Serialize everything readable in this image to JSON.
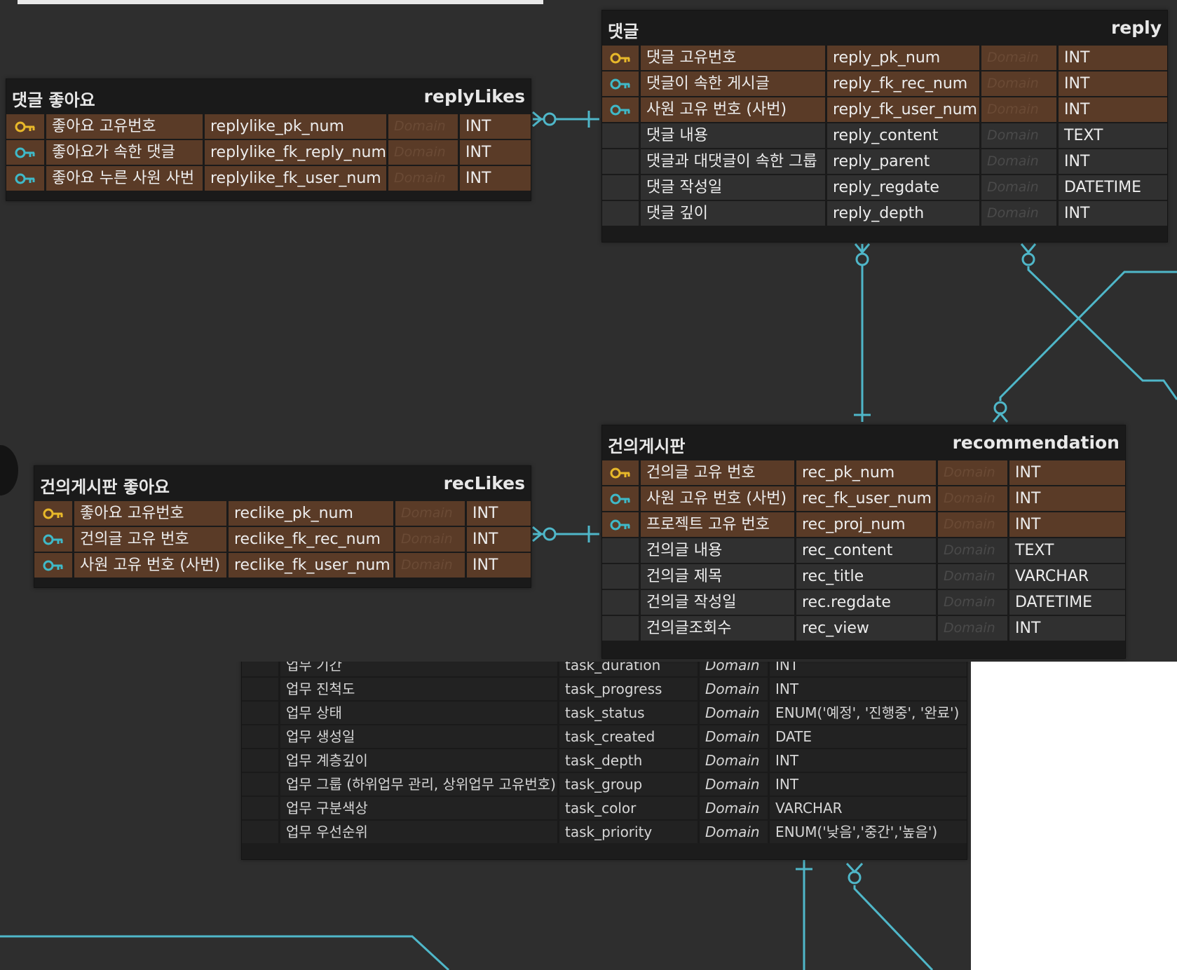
{
  "colors": {
    "link": "#4fb7c9",
    "key_row": "#5a3b27",
    "pk_icon": "#e8b82a",
    "fk_icon": "#3fb9c8",
    "panel": "#2e2e2e"
  },
  "tables": {
    "replyLikes": {
      "kor": "댓글 좋아요",
      "eng": "replyLikes",
      "rows": [
        {
          "icon": "pk-key-icon",
          "kor": "좋아요 고유번호",
          "eng": "replylike_pk_num",
          "domain": "Domain",
          "type": "INT"
        },
        {
          "icon": "fk-key-icon",
          "kor": "좋아요가 속한 댓글",
          "eng": "replylike_fk_reply_num",
          "domain": "Domain",
          "type": "INT"
        },
        {
          "icon": "fk-key-icon",
          "kor": "좋아요 누른 사원 사번",
          "eng": "replylike_fk_user_num",
          "domain": "Domain",
          "type": "INT"
        }
      ]
    },
    "reply": {
      "kor": "댓글",
      "eng": "reply",
      "rows": [
        {
          "icon": "pk-key-icon",
          "kor": "댓글 고유번호",
          "eng": "reply_pk_num",
          "domain": "Domain",
          "type": "INT"
        },
        {
          "icon": "fk-key-icon",
          "kor": "댓글이 속한 게시글",
          "eng": "reply_fk_rec_num",
          "domain": "Domain",
          "type": "INT"
        },
        {
          "icon": "fk-key-icon",
          "kor": "사원 고유 번호 (사번)",
          "eng": "reply_fk_user_num",
          "domain": "Domain",
          "type": "INT"
        },
        {
          "icon": "",
          "kor": "댓글 내용",
          "eng": "reply_content",
          "domain": "Domain",
          "type": "TEXT"
        },
        {
          "icon": "",
          "kor": "댓글과 대댓글이 속한 그룹",
          "eng": "reply_parent",
          "domain": "Domain",
          "type": "INT"
        },
        {
          "icon": "",
          "kor": "댓글 작성일",
          "eng": "reply_regdate",
          "domain": "Domain",
          "type": "DATETIME"
        },
        {
          "icon": "",
          "kor": "댓글 깊이",
          "eng": "reply_depth",
          "domain": "Domain",
          "type": "INT"
        }
      ]
    },
    "recLikes": {
      "kor": "건의게시판 좋아요",
      "eng": "recLikes",
      "rows": [
        {
          "icon": "pk-key-icon",
          "kor": "좋아요 고유번호",
          "eng": "reclike_pk_num",
          "domain": "Domain",
          "type": "INT"
        },
        {
          "icon": "fk-key-icon",
          "kor": "건의글 고유 번호",
          "eng": "reclike_fk_rec_num",
          "domain": "Domain",
          "type": "INT"
        },
        {
          "icon": "fk-key-icon",
          "kor": "사원 고유 번호 (사번)",
          "eng": "reclike_fk_user_num",
          "domain": "Domain",
          "type": "INT"
        }
      ]
    },
    "recommendation": {
      "kor": "건의게시판",
      "eng": "recommendation",
      "rows": [
        {
          "icon": "pk-key-icon",
          "kor": "건의글 고유 번호",
          "eng": "rec_pk_num",
          "domain": "Domain",
          "type": "INT"
        },
        {
          "icon": "fk-key-icon",
          "kor": "사원 고유 번호 (사번)",
          "eng": "rec_fk_user_num",
          "domain": "Domain",
          "type": "INT"
        },
        {
          "icon": "fk-key-icon",
          "kor": "프로젝트 고유 번호",
          "eng": "rec_proj_num",
          "domain": "Domain",
          "type": "INT"
        },
        {
          "icon": "",
          "kor": "건의글 내용",
          "eng": "rec_content",
          "domain": "Domain",
          "type": "TEXT"
        },
        {
          "icon": "",
          "kor": "건의글 제목",
          "eng": "rec_title",
          "domain": "Domain",
          "type": "VARCHAR"
        },
        {
          "icon": "",
          "kor": "건의글 작성일",
          "eng": "rec.regdate",
          "domain": "Domain",
          "type": "DATETIME"
        },
        {
          "icon": "",
          "kor": "건의글조회수",
          "eng": "rec_view",
          "domain": "Domain",
          "type": "INT"
        }
      ]
    },
    "task": {
      "rows": [
        {
          "kor": "업무 기간",
          "eng": "task_duration",
          "domain": "Domain",
          "type": "INT"
        },
        {
          "kor": "업무 진척도",
          "eng": "task_progress",
          "domain": "Domain",
          "type": "INT"
        },
        {
          "kor": "업무 상태",
          "eng": "task_status",
          "domain": "Domain",
          "type": "ENUM('예정', '진행중', '완료')"
        },
        {
          "kor": "업무 생성일",
          "eng": "task_created",
          "domain": "Domain",
          "type": "DATE"
        },
        {
          "kor": "업무 계층깊이",
          "eng": "task_depth",
          "domain": "Domain",
          "type": "INT"
        },
        {
          "kor": "업무 그룹 (하위업무 관리, 상위업무 고유번호)",
          "eng": "task_group",
          "domain": "Domain",
          "type": "INT"
        },
        {
          "kor": "업무 구분색상",
          "eng": "task_color",
          "domain": "Domain",
          "type": "VARCHAR"
        },
        {
          "kor": "업무 우선순위",
          "eng": "task_priority",
          "domain": "Domain",
          "type": "ENUM('낮음','중간','높음')"
        }
      ]
    }
  }
}
